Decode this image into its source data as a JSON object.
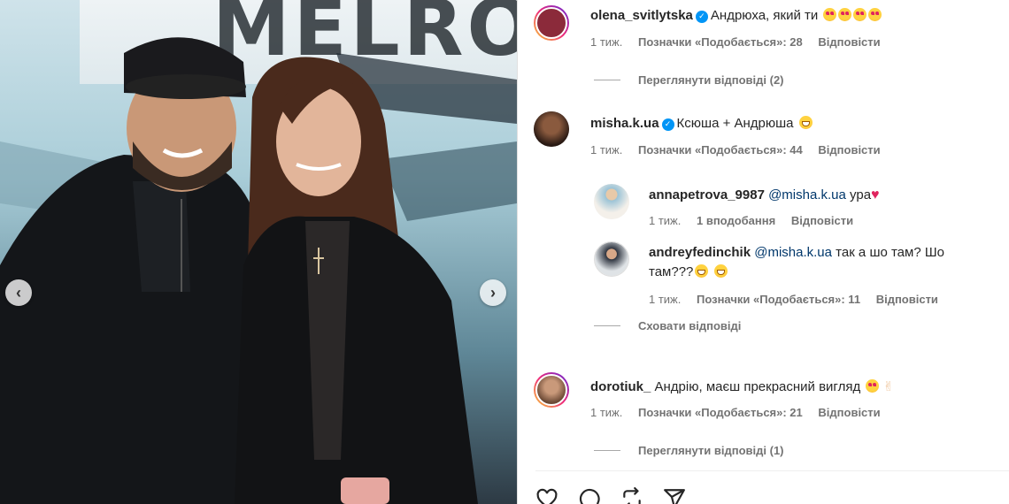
{
  "photo": {
    "banner_text": "MELROC"
  },
  "comments": [
    {
      "user": "olena_svitlytska",
      "verified": true,
      "text": "Андрюха, який ти",
      "emojis": [
        "heart-eyes",
        "heart-eyes",
        "heart-eyes",
        "heart-eyes"
      ],
      "time": "1 тиж.",
      "likes": "Позначки «Подобається»: 28",
      "reply": "Відповісти",
      "thread": "Переглянути відповіді (2)",
      "avatar_color": "#8b2a3a"
    },
    {
      "user": "misha.k.ua",
      "verified": true,
      "text": "Ксюша + Андрюша",
      "emojis": [
        "grin"
      ],
      "time": "1 тиж.",
      "likes": "Позначки «Подобається»: 44",
      "reply": "Відповісти",
      "avatar_color": "#3a2a22",
      "replies": [
        {
          "user": "annapetrova_9987",
          "mention": "@misha.k.ua",
          "text": "ура",
          "emojis": [
            "heart"
          ],
          "time": "1 тиж.",
          "likes": "1 вподобання",
          "reply": "Відповісти",
          "avatar_color": "#c9b9a8"
        },
        {
          "user": "andreyfedinchik",
          "mention": "@misha.k.ua",
          "text": "так а шо там? Шо",
          "text_line2": "там???",
          "emojis": [
            "grin",
            "grin"
          ],
          "time": "1 тиж.",
          "likes": "Позначки «Подобається»: 11",
          "reply": "Відповісти",
          "avatar_color": "#2f3540"
        }
      ],
      "hide_thread": "Сховати відповіді"
    },
    {
      "user": "dorotiuk_",
      "verified": false,
      "text": "Андрію, маєш прекрасний вигляд",
      "emojis": [
        "heart-eyes",
        "peace"
      ],
      "time": "1 тиж.",
      "likes": "Позначки «Подобається»: 21",
      "reply": "Відповісти",
      "thread": "Переглянути відповіді (1)",
      "avatar_color": "#a97b5e"
    }
  ],
  "actions": {
    "icons": [
      "heart-icon",
      "comment-icon",
      "share-icon",
      "send-icon"
    ]
  }
}
